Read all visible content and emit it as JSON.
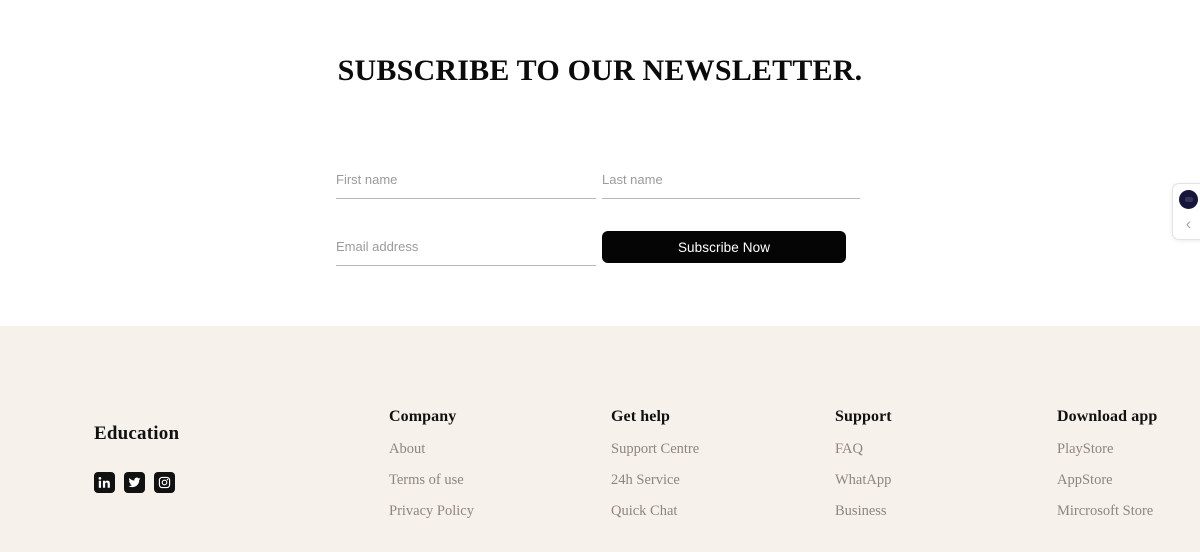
{
  "newsletter": {
    "title": "SUBSCRIBE TO OUR NEWSLETTER.",
    "fields": {
      "first_name_placeholder": "First name",
      "first_name_value": "",
      "last_name_placeholder": "Last name",
      "last_name_value": "",
      "email_placeholder": "Email address",
      "email_value": ""
    },
    "submit_label": "Subscribe Now"
  },
  "footer": {
    "background_color": "#f7f1ec",
    "brand": {
      "name": "Education",
      "socials": [
        {
          "name": "linkedin-icon",
          "label": "LinkedIn"
        },
        {
          "name": "twitter-icon",
          "label": "Twitter"
        },
        {
          "name": "instagram-icon",
          "label": "Instagram"
        }
      ]
    },
    "columns": [
      {
        "heading": "Company",
        "links": [
          "About",
          "Terms of use",
          "Privacy Policy"
        ]
      },
      {
        "heading": "Get help",
        "links": [
          "Support Centre",
          "24h Service",
          "Quick Chat"
        ]
      },
      {
        "heading": "Support",
        "links": [
          "FAQ",
          "WhatApp",
          "Business"
        ]
      },
      {
        "heading": "Download app",
        "links": [
          "PlayStore",
          "AppStore",
          "Mircrosoft Store"
        ]
      }
    ]
  },
  "side_widget": {
    "avatar_color": "#16163a",
    "collapse_label": "‹"
  }
}
